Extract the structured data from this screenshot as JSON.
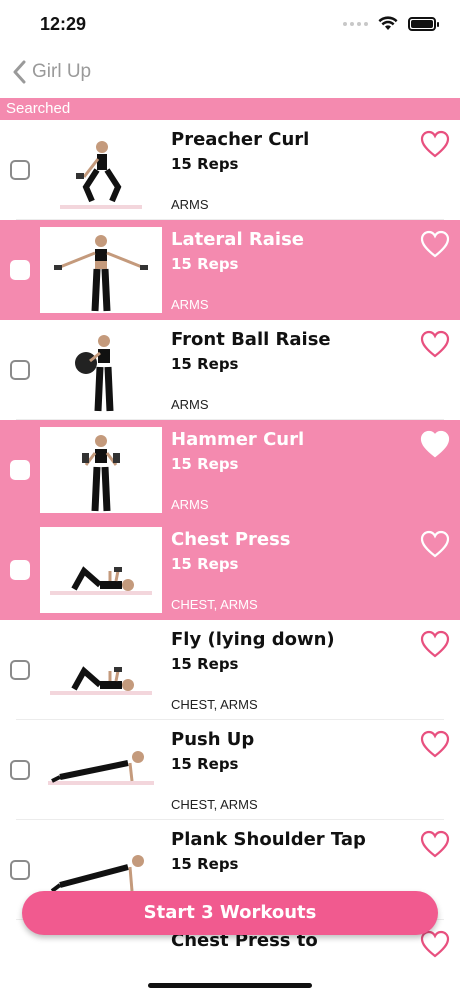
{
  "status_bar": {
    "time": "12:29"
  },
  "nav": {
    "back_label": "Girl Up"
  },
  "section": {
    "header": "Searched"
  },
  "exercises": [
    {
      "title": "Preacher Curl",
      "reps": "15 Reps",
      "tags": "ARMS",
      "selected": false,
      "favorite": false,
      "image": "squat-curl-figure"
    },
    {
      "title": "Lateral Raise",
      "reps": "15 Reps",
      "tags": "ARMS",
      "selected": true,
      "favorite": false,
      "image": "arms-out-figure"
    },
    {
      "title": "Front Ball Raise",
      "reps": "15 Reps",
      "tags": "ARMS",
      "selected": false,
      "favorite": false,
      "image": "ball-figure"
    },
    {
      "title": "Hammer Curl",
      "reps": "15 Reps",
      "tags": "ARMS",
      "selected": true,
      "favorite": true,
      "image": "curl-figure"
    },
    {
      "title": "Chest Press",
      "reps": "15 Reps",
      "tags": "CHEST, ARMS",
      "selected": true,
      "favorite": false,
      "image": "lying-figure"
    },
    {
      "title": "Fly (lying down)",
      "reps": "15 Reps",
      "tags": "CHEST, ARMS",
      "selected": false,
      "favorite": false,
      "image": "lying-figure"
    },
    {
      "title": "Push Up",
      "reps": "15 Reps",
      "tags": "CHEST, ARMS",
      "selected": false,
      "favorite": false,
      "image": "pushup-figure"
    },
    {
      "title": "Plank Shoulder Tap",
      "reps": "15 Reps",
      "tags": "",
      "selected": false,
      "favorite": false,
      "image": "plank-figure"
    }
  ],
  "partial_item": {
    "title": "Chest Press to"
  },
  "cta": {
    "label": "Start 3 Workouts"
  },
  "colors": {
    "accent": "#f48aaf",
    "cta": "#f15a8f",
    "heart": "#e8507f"
  }
}
